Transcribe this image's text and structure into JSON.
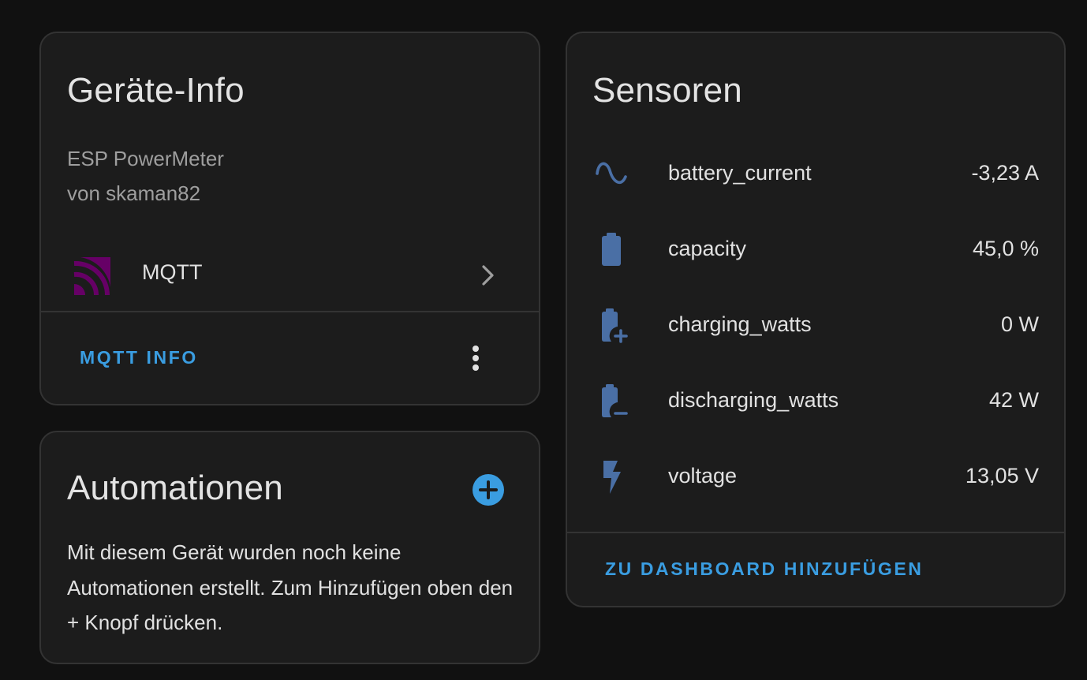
{
  "colors": {
    "background": "#111111",
    "card": "#1c1c1c",
    "border": "#333333",
    "accent": "#3a9de1",
    "sensor_icon": "#4a6fa5",
    "mqtt_logo": "#660066"
  },
  "device_info": {
    "title": "Geräte-Info",
    "model": "ESP PowerMeter",
    "manufacturer": "von skaman82",
    "integration": {
      "icon": "mqtt-logo",
      "label": "MQTT"
    },
    "action_label": "MQTT INFO"
  },
  "automations": {
    "title": "Automationen",
    "empty_text": "Mit diesem Gerät wurden noch keine Automationen erstellt. Zum Hinzufügen oben den + Knopf drücken."
  },
  "sensors": {
    "title": "Sensoren",
    "items": [
      {
        "icon": "sine-wave-icon",
        "name": "battery_current",
        "value": "-3,23 A"
      },
      {
        "icon": "battery-icon",
        "name": "capacity",
        "value": "45,0 %"
      },
      {
        "icon": "battery-plus-icon",
        "name": "charging_watts",
        "value": "0 W"
      },
      {
        "icon": "battery-minus-icon",
        "name": "discharging_watts",
        "value": "42 W"
      },
      {
        "icon": "flash-icon",
        "name": "voltage",
        "value": "13,05 V"
      }
    ],
    "action_label": "ZU DASHBOARD HINZUFÜGEN"
  }
}
